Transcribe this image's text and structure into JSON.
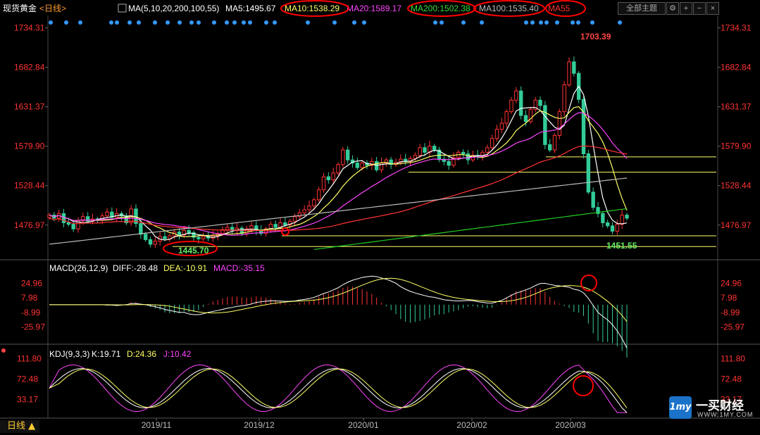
{
  "header": {
    "instrument": "现货黄金",
    "period_tag": "<日线>",
    "ma_group": "MA(5,10,20,200,100,55)",
    "ma5": "MA5:1495.67",
    "ma10": "MA10:1538.29",
    "ma20": "MA20:1589.17",
    "ma200": "MA200:1502.38",
    "ma100": "MA100:1535.40",
    "ma55": "MA55",
    "theme_button": "全部主题"
  },
  "colors": {
    "up": "#ff3333",
    "down": "#33cc99",
    "ma5": "#ffffff",
    "ma10": "#ffff66",
    "ma20": "#ff44ff",
    "ma55": "#ff3333",
    "ma100": "#bbbbbb",
    "ma200": "#22cc22",
    "axis_label": "#ff3333",
    "annotation_circle": "#ff0000",
    "hline": "#ffff66"
  },
  "price_axis": {
    "ticks": [
      "1734.31",
      "1682.84",
      "1631.37",
      "1579.90",
      "1528.44",
      "1476.97"
    ]
  },
  "annotations": {
    "high": "1703.39",
    "low_left": "1445.70",
    "low_right": "1451.55"
  },
  "macd": {
    "label": "MACD(26,12,9)",
    "diff": "DIFF:-28.48",
    "dea": "DEA:-10.91",
    "macd": "MACD:-35.15",
    "ticks": [
      "24.96",
      "7.98",
      "-8.99",
      "-25.97"
    ]
  },
  "kdj": {
    "label": "KDJ(9,3,3)",
    "k": "K:19.71",
    "d": "D:24.36",
    "j": "J:10.42",
    "ticks": [
      "111.80",
      "72.48",
      "33.17"
    ]
  },
  "x_axis": {
    "labels": [
      "2019/11",
      "2019/12",
      "2020/01",
      "2020/02",
      "2020/03"
    ]
  },
  "period_button": "日线 ▲",
  "brand": {
    "name": "一买财经",
    "url": "WWW.1MY.COM",
    "logo": "1my"
  },
  "chart_data": {
    "type": "candlestick",
    "title": "现货黄金",
    "price_range": [
      1440,
      1745
    ],
    "x": [
      "2019/11",
      "2019/12",
      "2020/01",
      "2020/02",
      "2020/03"
    ],
    "series": [
      {
        "name": "MA5",
        "values": [
          1495.67
        ]
      },
      {
        "name": "MA10",
        "values": [
          1538.29
        ]
      },
      {
        "name": "MA20",
        "values": [
          1589.17
        ]
      },
      {
        "name": "MA200",
        "values": [
          1502.38
        ]
      },
      {
        "name": "MA100",
        "values": [
          1535.4
        ]
      }
    ],
    "high": 1703.39,
    "lows": [
      1445.7,
      1451.55
    ],
    "horizontal_levels": [
      1566,
      1546,
      1463,
      1449
    ],
    "macd": {
      "diff": -28.48,
      "dea": -10.91,
      "macd": -35.15
    },
    "kdj": {
      "k": 19.71,
      "d": 24.36,
      "j": 10.42
    }
  }
}
